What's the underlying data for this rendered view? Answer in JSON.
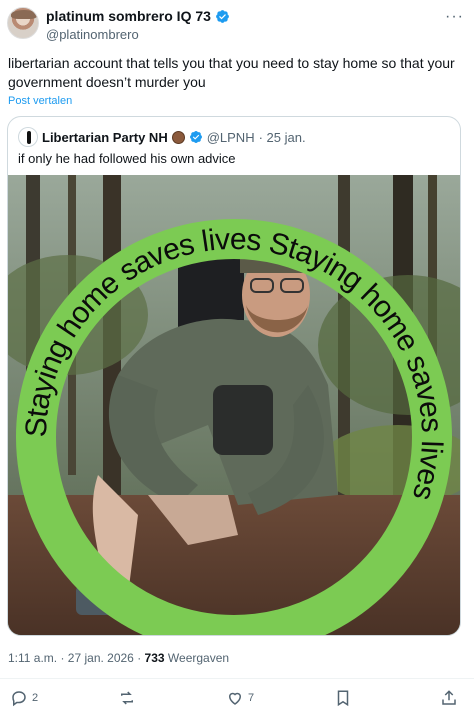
{
  "author": {
    "name": "platinum sombrero IQ 73",
    "handle": "@platinombrero"
  },
  "post": {
    "text": "libertarian account that tells you that you need to stay home so that your government doesn’t murder you",
    "translate_label": "Post vertalen",
    "timestamp": "1:11 a.m. · 27 jan. 2026 ·",
    "views_count": "733",
    "views_label": "Weergaven"
  },
  "quote": {
    "name": "Libertarian Party NH",
    "handle": "@LPNH",
    "time": "· 25 jan.",
    "text": "if only he had followed his own advice",
    "image_ring_text": "Staying home saves lives Staying home saves lives "
  },
  "actions": {
    "replies": "2",
    "likes": "7"
  },
  "colors": {
    "ring_green": "#7ccb53",
    "link_blue": "#1d9bf0",
    "muted": "#536471"
  },
  "icons": [
    "more-icon",
    "verified-badge-icon",
    "torch-logo-icon",
    "reply-icon",
    "repost-icon",
    "like-icon",
    "bookmark-icon",
    "share-icon"
  ]
}
